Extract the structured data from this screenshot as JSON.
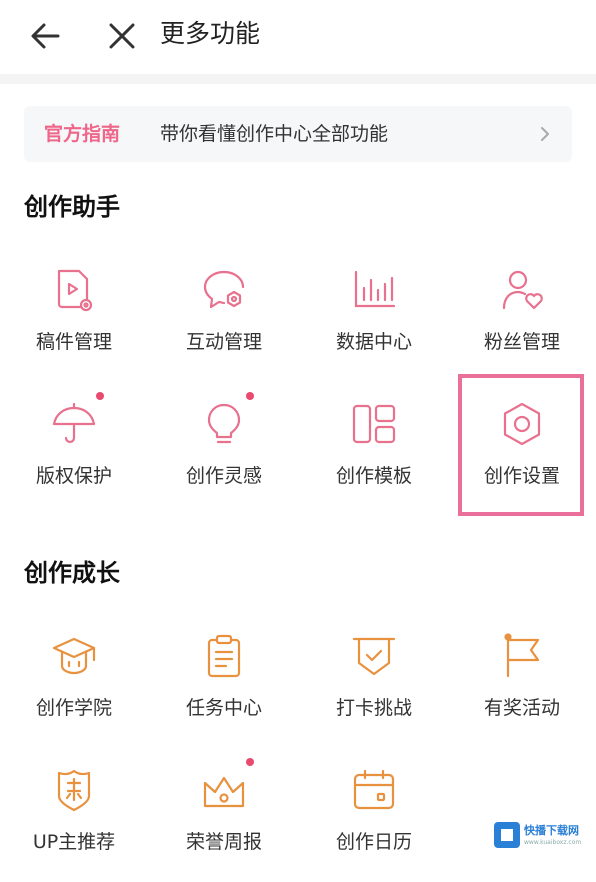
{
  "header": {
    "title": "更多功能"
  },
  "guide": {
    "tag": "官方指南",
    "text": "带你看懂创作中心全部功能"
  },
  "sections": [
    {
      "title": "创作助手",
      "items": [
        {
          "label": "稿件管理",
          "icon": "manuscript-icon"
        },
        {
          "label": "互动管理",
          "icon": "comment-settings-icon"
        },
        {
          "label": "数据中心",
          "icon": "bar-chart-icon"
        },
        {
          "label": "粉丝管理",
          "icon": "user-heart-icon"
        },
        {
          "label": "版权保护",
          "icon": "umbrella-icon",
          "badge": true
        },
        {
          "label": "创作灵感",
          "icon": "lightbulb-icon",
          "badge": true
        },
        {
          "label": "创作模板",
          "icon": "template-grid-icon"
        },
        {
          "label": "创作设置",
          "icon": "hexagon-gear-icon",
          "highlighted": true
        }
      ]
    },
    {
      "title": "创作成长",
      "items": [
        {
          "label": "创作学院",
          "icon": "graduation-cap-icon"
        },
        {
          "label": "任务中心",
          "icon": "clipboard-icon"
        },
        {
          "label": "打卡挑战",
          "icon": "shield-check-icon"
        },
        {
          "label": "有奖活动",
          "icon": "flag-icon"
        },
        {
          "label": "UP主推荐",
          "icon": "badge-icon"
        },
        {
          "label": "荣誉周报",
          "icon": "crown-icon",
          "badge": true
        },
        {
          "label": "创作日历",
          "icon": "calendar-icon"
        }
      ]
    }
  ],
  "colors": {
    "pink": "#e8718e",
    "orange": "#e8913f",
    "badge": "#e84a70",
    "highlight": "#ea6f9a"
  },
  "watermark": {
    "title": "快播下载网",
    "sub": "www.kuaiboxz.com"
  }
}
